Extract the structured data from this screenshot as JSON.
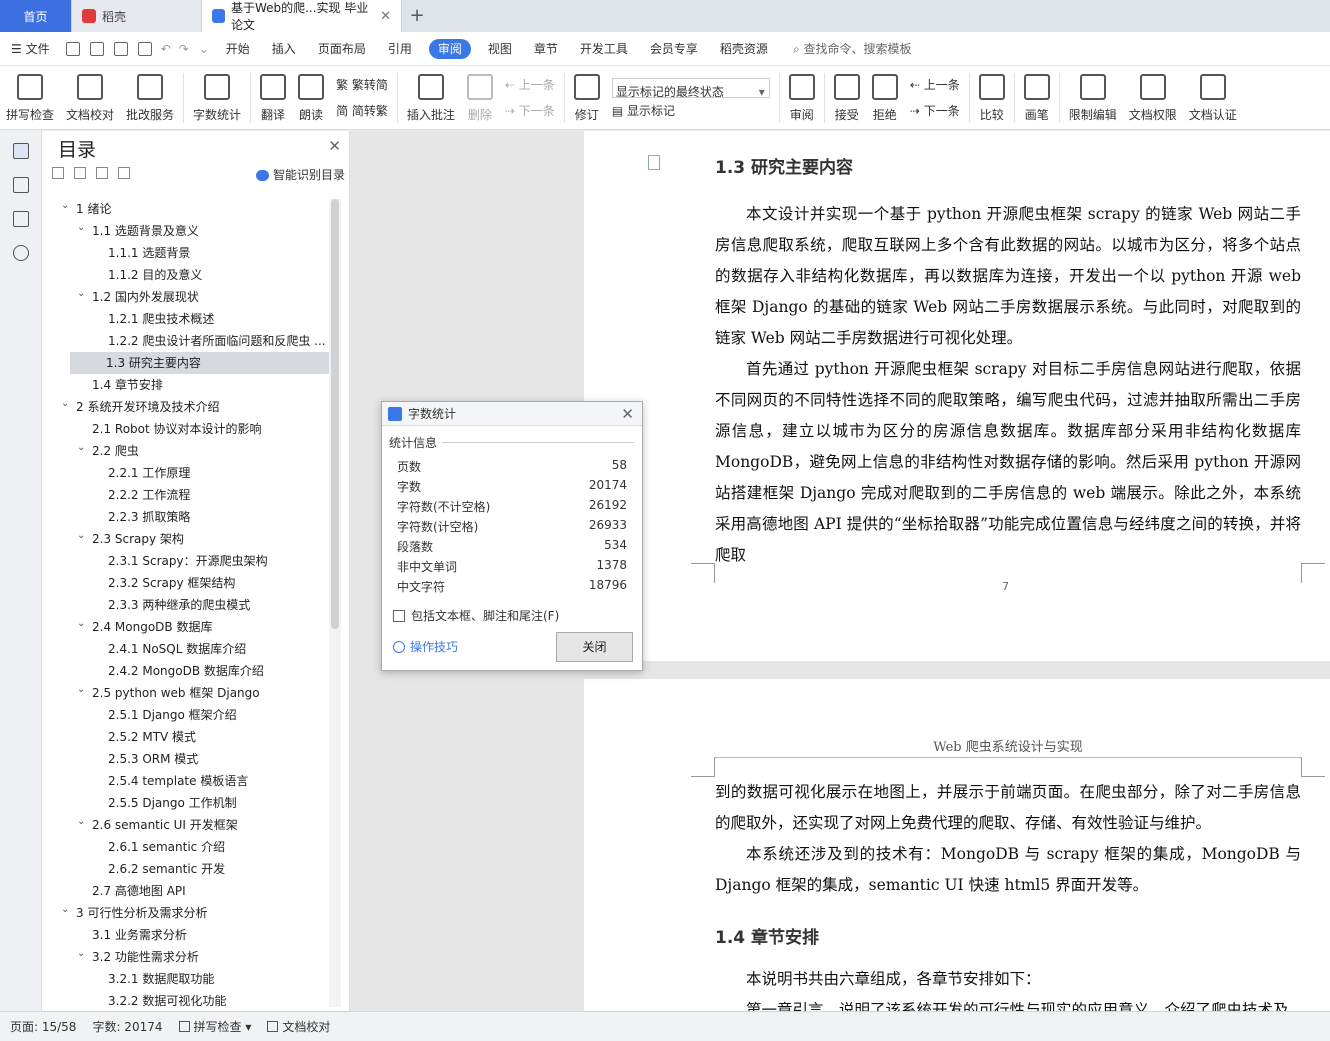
{
  "tabs": {
    "home": "首页",
    "daoke": "稻壳",
    "doc": "基于Web的爬...实现 毕业论文"
  },
  "menu": {
    "file": "文件",
    "items": [
      "开始",
      "插入",
      "页面布局",
      "引用",
      "审阅",
      "视图",
      "章节",
      "开发工具",
      "会员专享",
      "稻壳资源"
    ],
    "active": "审阅",
    "search": "查找命令、搜索模板"
  },
  "ribbon": {
    "spellcheck": "拼写检查",
    "doccheck": "文档校对",
    "annotate_service": "批改服务",
    "wordcount": "字数统计",
    "translate": "翻译",
    "read": "朗读",
    "trad_to_simp": "繁转简",
    "simp_to_trad": "简转繁",
    "insert_comment": "插入批注",
    "delete": "删除",
    "prev": "上一条",
    "next": "下一条",
    "revise": "修订",
    "markup_select": "显示标记的最终状态",
    "show_markup": "显示标记",
    "review": "审阅",
    "accept": "接受",
    "reject": "拒绝",
    "prev2": "上一条",
    "next2": "下一条",
    "compare": "比较",
    "pen": "画笔",
    "restrict_edit": "限制编辑",
    "doc_permission": "文档权限",
    "doc_cert": "文档认证"
  },
  "toc": {
    "title": "目录",
    "smart": "智能识别目录",
    "items": [
      {
        "text": "1  绪论",
        "level": 0,
        "caret": true
      },
      {
        "text": "1.1  选题背景及意义",
        "level": 1,
        "caret": true
      },
      {
        "text": "1.1.1 选题背景",
        "level": 2
      },
      {
        "text": "1.1.2 目的及意义",
        "level": 2
      },
      {
        "text": "1.2  国内外发展现状",
        "level": 1,
        "caret": true
      },
      {
        "text": "1.2.1  爬虫技术概述",
        "level": 2
      },
      {
        "text": "1.2.2  爬虫设计者所面临问题和反爬虫 ...",
        "level": 2
      },
      {
        "text": "1.3  研究主要内容",
        "level": 1,
        "selected": true
      },
      {
        "text": "1.4  章节安排",
        "level": 1
      },
      {
        "text": "2  系统开发环境及技术介绍",
        "level": 0,
        "caret": true
      },
      {
        "text": "2.1 Robot 协议对本设计的影响",
        "level": 1
      },
      {
        "text": "2.2  爬虫",
        "level": 1,
        "caret": true
      },
      {
        "text": "2.2.1  工作原理",
        "level": 2
      },
      {
        "text": "2.2.2  工作流程",
        "level": 2
      },
      {
        "text": "2.2.3  抓取策略",
        "level": 2
      },
      {
        "text": "2.3 Scrapy 架构",
        "level": 1,
        "caret": true
      },
      {
        "text": "2.3.1 Scrapy：开源爬虫架构",
        "level": 2
      },
      {
        "text": "2.3.2 Scrapy 框架结构",
        "level": 2
      },
      {
        "text": "2.3.3  两种继承的爬虫模式",
        "level": 2
      },
      {
        "text": "2.4 MongoDB 数据库",
        "level": 1,
        "caret": true
      },
      {
        "text": "2.4.1 NoSQL 数据库介绍",
        "level": 2
      },
      {
        "text": "2.4.2 MongoDB 数据库介绍",
        "level": 2
      },
      {
        "text": "2.5 python web 框架 Django",
        "level": 1,
        "caret": true
      },
      {
        "text": "2.5.1 Django 框架介绍",
        "level": 2
      },
      {
        "text": "2.5.2 MTV 模式",
        "level": 2
      },
      {
        "text": "2.5.3 ORM 模式",
        "level": 2
      },
      {
        "text": "2.5.4 template 模板语言",
        "level": 2
      },
      {
        "text": "2.5.5 Django 工作机制",
        "level": 2
      },
      {
        "text": "2.6 semantic UI 开发框架",
        "level": 1,
        "caret": true
      },
      {
        "text": "2.6.1 semantic 介绍",
        "level": 2
      },
      {
        "text": "2.6.2 semantic 开发",
        "level": 2
      },
      {
        "text": "2.7  高德地图 API",
        "level": 1
      },
      {
        "text": "3  可行性分析及需求分析",
        "level": 0,
        "caret": true
      },
      {
        "text": "3.1  业务需求分析",
        "level": 1
      },
      {
        "text": "3.2  功能性需求分析",
        "level": 1,
        "caret": true
      },
      {
        "text": "3.2.1  数据爬取功能",
        "level": 2
      },
      {
        "text": "3.2.2  数据可视化功能",
        "level": 2
      }
    ]
  },
  "page1": {
    "heading": "1.3  研究主要内容",
    "para1": "本文设计并实现一个基于 python 开源爬虫框架 scrapy 的链家 Web 网站二手房信息爬取系统，爬取互联网上多个含有此数据的网站。以城市为区分，将多个站点的数据存入非结构化数据库，再以数据库为连接，开发出一个以 python 开源 web 框架 Django 的基础的链家 Web 网站二手房数据展示系统。与此同时，对爬取到的链家 Web 网站二手房数据进行可视化处理。",
    "para2": "首先通过 python 开源爬虫框架 scrapy 对目标二手房信息网站进行爬取，依据不同网页的不同特性选择不同的爬取策略，编写爬虫代码，过滤并抽取所需出二手房源信息，建立以城市为区分的房源信息数据库。数据库部分采用非结构化数据库 MongoDB，避免网上信息的非结构性对数据存储的影响。然后采用 python 开源网站搭建框架 Django 完成对爬取到的二手房信息的 web 端展示。除此之外，本系统采用高德地图 API 提供的“坐标拾取器”功能完成位置信息与经纬度之间的转换，并将爬取",
    "page_number": "7"
  },
  "page2": {
    "header": "Web 爬虫系统设计与实现",
    "para1": "到的数据可视化展示在地图上，并展示于前端页面。在爬虫部分，除了对二手房信息的爬取外，还实现了对网上免费代理的爬取、存储、有效性验证与维护。",
    "para2": "本系统还涉及到的技术有：MongoDB 与 scrapy 框架的集成，MongoDB 与 Django 框架的集成，semantic UI 快速 html5 界面开发等。",
    "heading": "1.4  章节安排",
    "para3": "本说明书共由六章组成，各章节安排如下：",
    "para4": "第一章引言，说明了该系统开发的可行性与现实的应用意义，介绍了爬虫技术及"
  },
  "dialog": {
    "title": "字数统计",
    "section": "统计信息",
    "rows": [
      {
        "label": "页数",
        "value": "58"
      },
      {
        "label": "字数",
        "value": "20174"
      },
      {
        "label": "字符数(不计空格)",
        "value": "26192"
      },
      {
        "label": "字符数(计空格)",
        "value": "26933"
      },
      {
        "label": "段落数",
        "value": "534"
      },
      {
        "label": "非中文单词",
        "value": "1378"
      },
      {
        "label": "中文字符",
        "value": "18796"
      }
    ],
    "checkbox": "包括文本框、脚注和尾注(F)",
    "tips": "操作技巧",
    "close": "关闭"
  },
  "status": {
    "page": "页面: 15/58",
    "words": "字数: 20174",
    "spell": "拼写检查",
    "proof": "文档校对"
  },
  "colors": {
    "accent": "#3b78e7",
    "home_tab": "#3c6fe0"
  }
}
